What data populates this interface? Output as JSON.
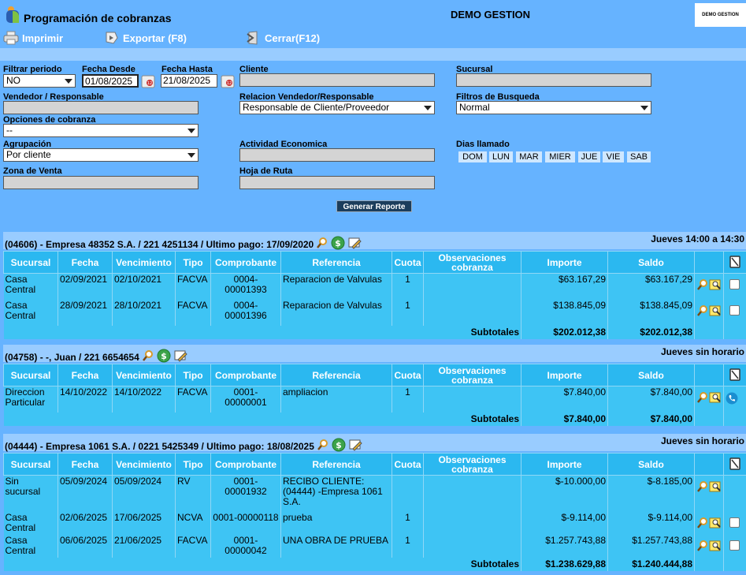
{
  "app": {
    "title": "Programación de cobranzas",
    "company": "DEMO GESTION",
    "company_logo": "DEMO GESTION"
  },
  "toolbar": {
    "print": "Imprimir",
    "export": "Exportar (F8)",
    "close": "Cerrar(F12)"
  },
  "filters": {
    "periodo_label": "Filtrar periodo",
    "periodo_value": "NO",
    "desde_label": "Fecha Desde",
    "desde_value": "01/08/2025",
    "hasta_label": "Fecha Hasta",
    "hasta_value": "21/08/2025",
    "cliente_label": "Cliente",
    "cliente_value": "",
    "sucursal_label": "Sucursal",
    "sucursal_value": "",
    "vendedor_label": "Vendedor / Responsable",
    "vendedor_value": "",
    "relacion_label": "Relacion Vendedor/Responsable",
    "relacion_value": "Responsable de Cliente/Proveedor",
    "busqueda_label": "Filtros de Busqueda",
    "busqueda_value": "Normal",
    "opciones_label": "Opciones de cobranza",
    "opciones_value": "--",
    "agrupacion_label": "Agrupación",
    "agrupacion_value": "Por cliente",
    "actividad_label": "Actividad Economica",
    "actividad_value": "",
    "dias_label": "Dias llamado",
    "dias": [
      "DOM",
      "LUN",
      "MAR",
      "MIER",
      "JUE",
      "VIE",
      "SAB"
    ],
    "zona_label": "Zona de Venta",
    "zona_value": "",
    "hoja_label": "Hoja de Ruta",
    "hoja_value": "",
    "generate": "Generar Reporte"
  },
  "columns": {
    "sucursal": "Sucursal",
    "fecha": "Fecha",
    "vencimiento": "Vencimiento",
    "tipo": "Tipo",
    "comprobante": "Comprobante",
    "referencia": "Referencia",
    "cuota": "Cuota",
    "observaciones": "Observaciones cobranza",
    "importe": "Importe",
    "saldo": "Saldo",
    "subtotales": "Subtotales"
  },
  "groups": [
    {
      "header": "(04606) - Empresa 48352 S.A. / 221 4251134 / Ultimo pago: 17/09/2020",
      "schedule": "Jueves 14:00 a 14:30",
      "rows": [
        {
          "sucursal": "Casa Central",
          "fecha": "02/09/2021",
          "vencimiento": "02/10/2021",
          "tipo": "FACVA",
          "comprobante": "0004-00001393",
          "referencia": "Reparacion de Valvulas",
          "cuota": "1",
          "observaciones": "",
          "importe": "$63.167,29",
          "saldo": "$63.167,29"
        },
        {
          "sucursal": "Casa Central",
          "fecha": "28/09/2021",
          "vencimiento": "28/10/2021",
          "tipo": "FACVA",
          "comprobante": "0004-00001396",
          "referencia": "Reparacion de Valvulas",
          "cuota": "1",
          "observaciones": "",
          "importe": "$138.845,09",
          "saldo": "$138.845,09"
        }
      ],
      "subtotal_importe": "$202.012,38",
      "subtotal_saldo": "$202.012,38"
    },
    {
      "header": "(04758) - -, Juan / 221 6654654",
      "schedule": "Jueves sin horario",
      "rows": [
        {
          "sucursal": "Direccion Particular",
          "fecha": "14/10/2022",
          "vencimiento": "14/10/2022",
          "tipo": "FACVA",
          "comprobante": "0001-00000001",
          "referencia": "ampliacion",
          "cuota": "1",
          "observaciones": "",
          "importe": "$7.840,00",
          "saldo": "$7.840,00"
        }
      ],
      "subtotal_importe": "$7.840,00",
      "subtotal_saldo": "$7.840,00"
    },
    {
      "header": "(04444) - Empresa 1061 S.A. / 0221 5425349 / Ultimo pago: 18/08/2025",
      "schedule": "Jueves sin horario",
      "rows": [
        {
          "sucursal": "Sin sucursal",
          "fecha": "05/09/2024",
          "vencimiento": "05/09/2024",
          "tipo": "RV",
          "comprobante": "0001-00001932",
          "referencia": "RECIBO CLIENTE: (04444) -Empresa 1061 S.A.",
          "cuota": "",
          "observaciones": "",
          "importe": "$-10.000,00",
          "saldo": "$-8.185,00"
        },
        {
          "sucursal": "Casa Central",
          "fecha": "02/06/2025",
          "vencimiento": "17/06/2025",
          "tipo": "NCVA",
          "comprobante": "0001-00000118",
          "referencia": "prueba",
          "cuota": "1",
          "observaciones": "",
          "importe": "$-9.114,00",
          "saldo": "$-9.114,00"
        },
        {
          "sucursal": "Casa Central",
          "fecha": "06/06/2025",
          "vencimiento": "21/06/2025",
          "tipo": "FACVA",
          "comprobante": "0001-00000042",
          "referencia": "UNA OBRA DE PRUEBA",
          "cuota": "1",
          "observaciones": "",
          "importe": "$1.257.743,88",
          "saldo": "$1.257.743,88"
        }
      ],
      "subtotal_importe": "$1.238.629,88",
      "subtotal_saldo": "$1.240.444,88"
    }
  ]
}
